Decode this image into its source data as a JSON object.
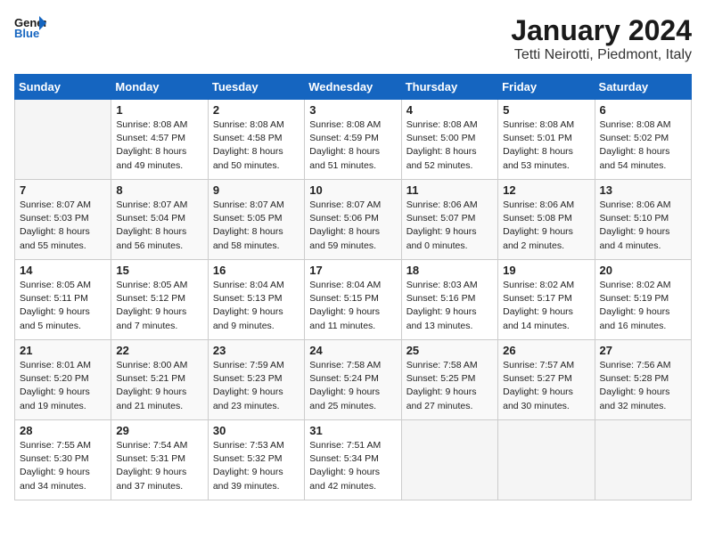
{
  "header": {
    "logo_line1": "General",
    "logo_line2": "Blue",
    "month": "January 2024",
    "location": "Tetti Neirotti, Piedmont, Italy"
  },
  "weekdays": [
    "Sunday",
    "Monday",
    "Tuesday",
    "Wednesday",
    "Thursday",
    "Friday",
    "Saturday"
  ],
  "weeks": [
    [
      {
        "day": "",
        "sunrise": "",
        "sunset": "",
        "daylight": ""
      },
      {
        "day": "1",
        "sunrise": "Sunrise: 8:08 AM",
        "sunset": "Sunset: 4:57 PM",
        "daylight": "Daylight: 8 hours and 49 minutes."
      },
      {
        "day": "2",
        "sunrise": "Sunrise: 8:08 AM",
        "sunset": "Sunset: 4:58 PM",
        "daylight": "Daylight: 8 hours and 50 minutes."
      },
      {
        "day": "3",
        "sunrise": "Sunrise: 8:08 AM",
        "sunset": "Sunset: 4:59 PM",
        "daylight": "Daylight: 8 hours and 51 minutes."
      },
      {
        "day": "4",
        "sunrise": "Sunrise: 8:08 AM",
        "sunset": "Sunset: 5:00 PM",
        "daylight": "Daylight: 8 hours and 52 minutes."
      },
      {
        "day": "5",
        "sunrise": "Sunrise: 8:08 AM",
        "sunset": "Sunset: 5:01 PM",
        "daylight": "Daylight: 8 hours and 53 minutes."
      },
      {
        "day": "6",
        "sunrise": "Sunrise: 8:08 AM",
        "sunset": "Sunset: 5:02 PM",
        "daylight": "Daylight: 8 hours and 54 minutes."
      }
    ],
    [
      {
        "day": "7",
        "sunrise": "Sunrise: 8:07 AM",
        "sunset": "Sunset: 5:03 PM",
        "daylight": "Daylight: 8 hours and 55 minutes."
      },
      {
        "day": "8",
        "sunrise": "Sunrise: 8:07 AM",
        "sunset": "Sunset: 5:04 PM",
        "daylight": "Daylight: 8 hours and 56 minutes."
      },
      {
        "day": "9",
        "sunrise": "Sunrise: 8:07 AM",
        "sunset": "Sunset: 5:05 PM",
        "daylight": "Daylight: 8 hours and 58 minutes."
      },
      {
        "day": "10",
        "sunrise": "Sunrise: 8:07 AM",
        "sunset": "Sunset: 5:06 PM",
        "daylight": "Daylight: 8 hours and 59 minutes."
      },
      {
        "day": "11",
        "sunrise": "Sunrise: 8:06 AM",
        "sunset": "Sunset: 5:07 PM",
        "daylight": "Daylight: 9 hours and 0 minutes."
      },
      {
        "day": "12",
        "sunrise": "Sunrise: 8:06 AM",
        "sunset": "Sunset: 5:08 PM",
        "daylight": "Daylight: 9 hours and 2 minutes."
      },
      {
        "day": "13",
        "sunrise": "Sunrise: 8:06 AM",
        "sunset": "Sunset: 5:10 PM",
        "daylight": "Daylight: 9 hours and 4 minutes."
      }
    ],
    [
      {
        "day": "14",
        "sunrise": "Sunrise: 8:05 AM",
        "sunset": "Sunset: 5:11 PM",
        "daylight": "Daylight: 9 hours and 5 minutes."
      },
      {
        "day": "15",
        "sunrise": "Sunrise: 8:05 AM",
        "sunset": "Sunset: 5:12 PM",
        "daylight": "Daylight: 9 hours and 7 minutes."
      },
      {
        "day": "16",
        "sunrise": "Sunrise: 8:04 AM",
        "sunset": "Sunset: 5:13 PM",
        "daylight": "Daylight: 9 hours and 9 minutes."
      },
      {
        "day": "17",
        "sunrise": "Sunrise: 8:04 AM",
        "sunset": "Sunset: 5:15 PM",
        "daylight": "Daylight: 9 hours and 11 minutes."
      },
      {
        "day": "18",
        "sunrise": "Sunrise: 8:03 AM",
        "sunset": "Sunset: 5:16 PM",
        "daylight": "Daylight: 9 hours and 13 minutes."
      },
      {
        "day": "19",
        "sunrise": "Sunrise: 8:02 AM",
        "sunset": "Sunset: 5:17 PM",
        "daylight": "Daylight: 9 hours and 14 minutes."
      },
      {
        "day": "20",
        "sunrise": "Sunrise: 8:02 AM",
        "sunset": "Sunset: 5:19 PM",
        "daylight": "Daylight: 9 hours and 16 minutes."
      }
    ],
    [
      {
        "day": "21",
        "sunrise": "Sunrise: 8:01 AM",
        "sunset": "Sunset: 5:20 PM",
        "daylight": "Daylight: 9 hours and 19 minutes."
      },
      {
        "day": "22",
        "sunrise": "Sunrise: 8:00 AM",
        "sunset": "Sunset: 5:21 PM",
        "daylight": "Daylight: 9 hours and 21 minutes."
      },
      {
        "day": "23",
        "sunrise": "Sunrise: 7:59 AM",
        "sunset": "Sunset: 5:23 PM",
        "daylight": "Daylight: 9 hours and 23 minutes."
      },
      {
        "day": "24",
        "sunrise": "Sunrise: 7:58 AM",
        "sunset": "Sunset: 5:24 PM",
        "daylight": "Daylight: 9 hours and 25 minutes."
      },
      {
        "day": "25",
        "sunrise": "Sunrise: 7:58 AM",
        "sunset": "Sunset: 5:25 PM",
        "daylight": "Daylight: 9 hours and 27 minutes."
      },
      {
        "day": "26",
        "sunrise": "Sunrise: 7:57 AM",
        "sunset": "Sunset: 5:27 PM",
        "daylight": "Daylight: 9 hours and 30 minutes."
      },
      {
        "day": "27",
        "sunrise": "Sunrise: 7:56 AM",
        "sunset": "Sunset: 5:28 PM",
        "daylight": "Daylight: 9 hours and 32 minutes."
      }
    ],
    [
      {
        "day": "28",
        "sunrise": "Sunrise: 7:55 AM",
        "sunset": "Sunset: 5:30 PM",
        "daylight": "Daylight: 9 hours and 34 minutes."
      },
      {
        "day": "29",
        "sunrise": "Sunrise: 7:54 AM",
        "sunset": "Sunset: 5:31 PM",
        "daylight": "Daylight: 9 hours and 37 minutes."
      },
      {
        "day": "30",
        "sunrise": "Sunrise: 7:53 AM",
        "sunset": "Sunset: 5:32 PM",
        "daylight": "Daylight: 9 hours and 39 minutes."
      },
      {
        "day": "31",
        "sunrise": "Sunrise: 7:51 AM",
        "sunset": "Sunset: 5:34 PM",
        "daylight": "Daylight: 9 hours and 42 minutes."
      },
      {
        "day": "",
        "sunrise": "",
        "sunset": "",
        "daylight": ""
      },
      {
        "day": "",
        "sunrise": "",
        "sunset": "",
        "daylight": ""
      },
      {
        "day": "",
        "sunrise": "",
        "sunset": "",
        "daylight": ""
      }
    ]
  ]
}
